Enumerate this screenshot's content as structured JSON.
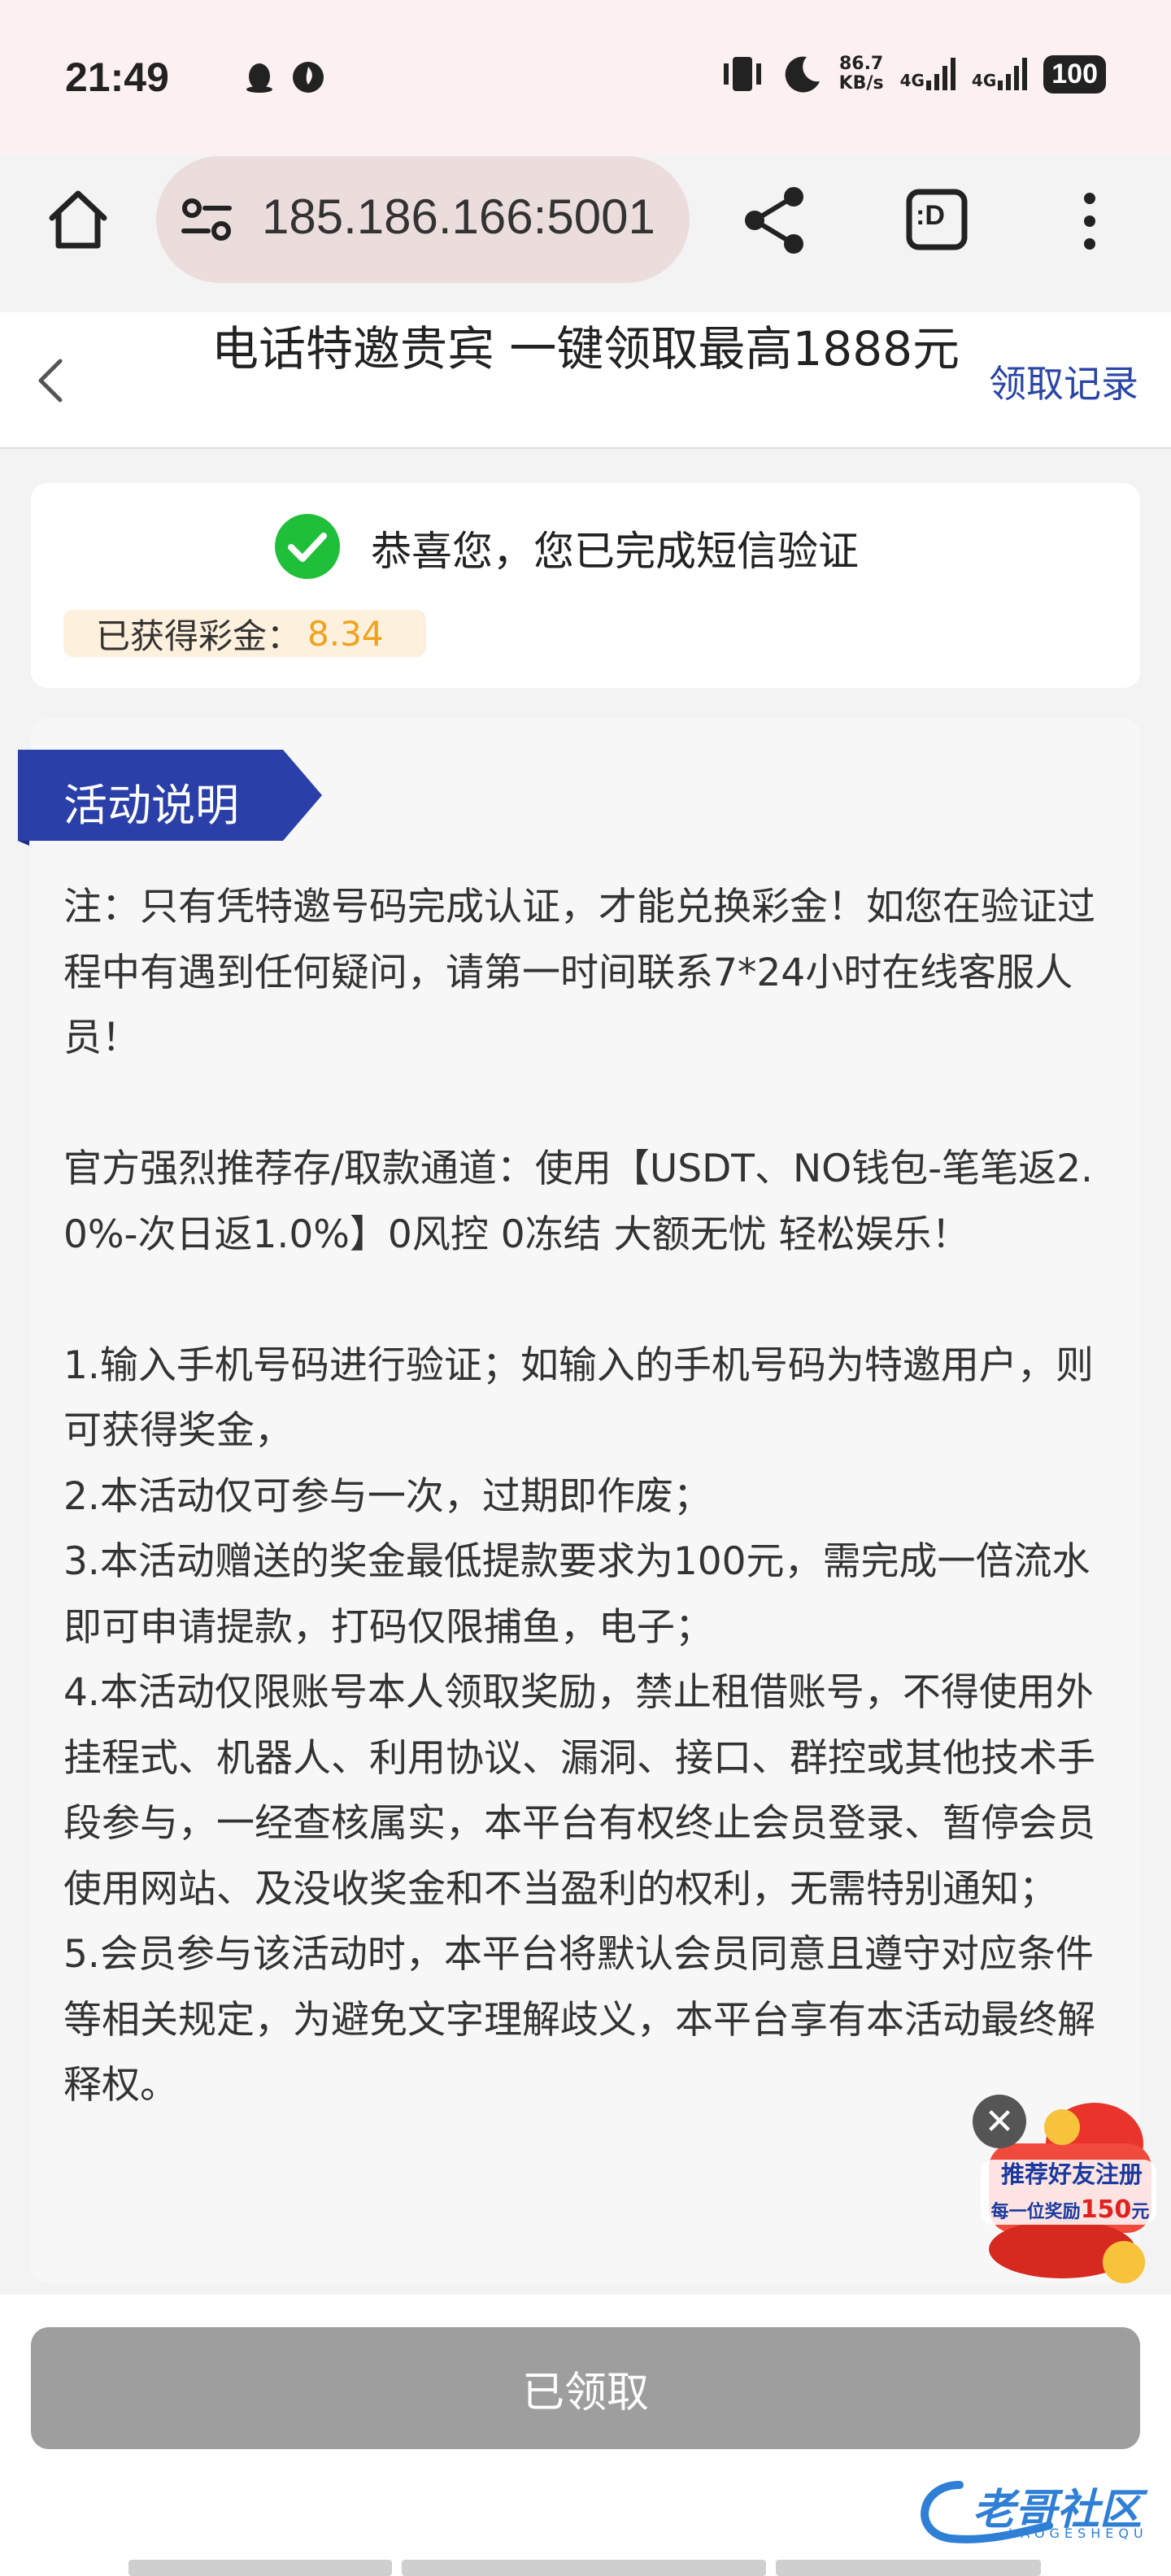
{
  "status_bar": {
    "time": "21:49",
    "net_speed_value": "86.7",
    "net_speed_unit": "KB/s",
    "signal1_label": "4G",
    "signal2_label": "4G",
    "battery": "100",
    "icons": [
      "qq-penguin-icon",
      "flame-app-icon",
      "vibrate-icon",
      "moon-icon",
      "signal-icon",
      "signal-icon",
      "battery-icon"
    ]
  },
  "browser": {
    "url": "185.186.166:5001",
    "tabs_label": ":D"
  },
  "header": {
    "title": "电话特邀贵宾 一键领取最高1888元",
    "records_label": "领取记录"
  },
  "success": {
    "message": "恭喜您，您已完成短信验证",
    "bonus_label": "已获得彩金：",
    "bonus_value": "8.34"
  },
  "activity": {
    "tag": "活动说明",
    "note": "注：只有凭特邀号码完成认证，才能兑换彩金！如您在验证过程中有遇到任何疑问，请第一时间联系7*24小时在线客服人员！",
    "recommend": "官方强烈推荐存/取款通道：使用【USDT、NO钱包-笔笔返2.0%-次日返1.0%】0风控 0冻结 大额无忧 轻松娱乐！",
    "rules": [
      "1.输入手机号码进行验证；如输入的手机号码为特邀用户，则可获得奖金，",
      "2.本活动仅可参与一次，过期即作废；",
      "3.本活动赠送的奖金最低提款要求为100元，需完成一倍流水即可申请提款，打码仅限捕鱼，电子；",
      "4.本活动仅限账号本人领取奖励，禁止租借账号，不得使用外挂程式、机器人、利用协议、漏洞、接口、群控或其他技术手段参与，一经查核属实，本平台有权终止会员登录、暂停会员使用网站、及没收奖金和不当盈利的权利，无需特别通知；",
      "5.会员参与该活动时，本平台将默认会员同意且遵守对应条件等相关规定，为避免文字理解歧义，本平台享有本活动最终解释权。"
    ]
  },
  "promo": {
    "title": "推荐好友注册",
    "sub_prefix": "每一位奖励",
    "amount": "150",
    "unit": "元"
  },
  "footer": {
    "claimed_button": "已领取",
    "watermark": "老哥社区",
    "watermark_sub": "LAOGESHEQU"
  },
  "colors": {
    "accent_blue": "#2a45a6",
    "success_green": "#1fbf3a",
    "bonus_orange": "#f0a21d",
    "disabled_gray": "#9e9e9e"
  }
}
